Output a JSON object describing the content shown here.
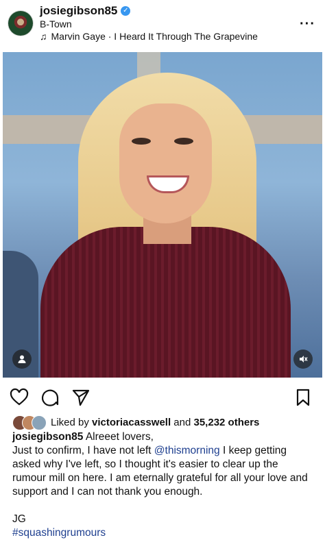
{
  "post": {
    "username": "josiegibson85",
    "location": "B-Town",
    "music": "Marvin Gaye · I Heard It Through The Grapevine"
  },
  "likes": {
    "prefix": "Liked by",
    "liker": "victoriacasswell",
    "joiner": "and",
    "others": "35,232 others"
  },
  "caption": {
    "username": "josiegibson85",
    "line1": "Alreeet lovers,",
    "body_start": "Just to confirm, I have not left",
    "mention": "@thismorning",
    "body_end": "I keep getting asked why I've left, so I thought it's easier to clear up the rumour mill on here. I am eternally grateful for all your love and support and I can not thank you enough.",
    "signature": "JG",
    "hashtag": "#squashingrumours"
  },
  "icons": {
    "verified": "verified-badge-icon",
    "music": "music-note-icon",
    "more": "more-options-icon",
    "like": "heart-icon",
    "comment": "comment-icon",
    "share": "send-icon",
    "save": "bookmark-icon",
    "tag": "user-tag-icon",
    "mute": "muted-speaker-icon"
  },
  "colors": {
    "verified": "#3897f0",
    "link": "#1e3f8f"
  }
}
